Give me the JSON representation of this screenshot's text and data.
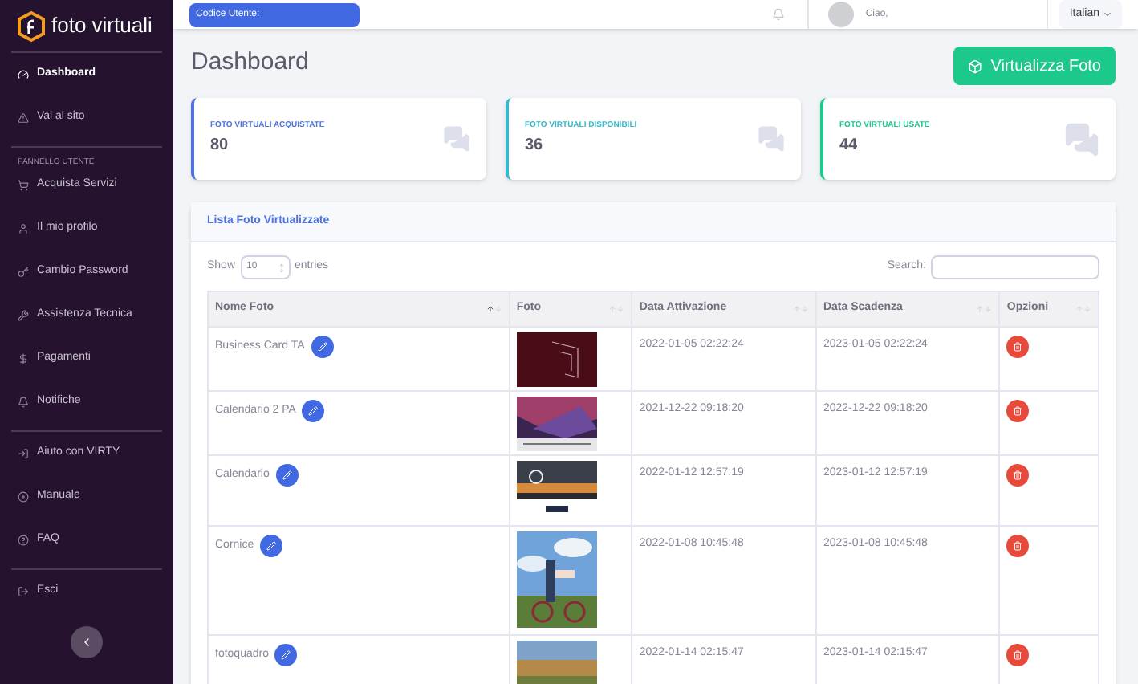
{
  "brand": {
    "name": "foto virtuali"
  },
  "sidebar": {
    "sections": [
      {
        "items": [
          {
            "label": "Dashboard",
            "selected": true
          },
          {
            "label": "Vai al sito",
            "selected": false
          }
        ]
      },
      {
        "heading": "PANNELLO UTENTE",
        "items": [
          {
            "label": "Acquista Servizi",
            "selected": false
          },
          {
            "label": "Il mio profilo",
            "selected": false
          },
          {
            "label": "Cambio Password",
            "selected": false
          },
          {
            "label": "Assistenza Tecnica",
            "selected": false
          },
          {
            "label": "Pagamenti",
            "selected": false
          },
          {
            "label": "Notifiche",
            "selected": false
          }
        ]
      },
      {
        "items": [
          {
            "label": "Aiuto con VIRTY",
            "selected": false
          },
          {
            "label": "Manuale",
            "selected": false
          },
          {
            "label": "FAQ",
            "selected": false
          }
        ]
      },
      {
        "items": [
          {
            "label": "Esci",
            "selected": false
          }
        ]
      }
    ]
  },
  "topbar": {
    "user_code": "Codice Utente:",
    "greeting": "Ciao,",
    "language": "Italian"
  },
  "page_title": "Dashboard",
  "primary_button": "Virtualizza Foto",
  "stats": [
    {
      "label": "FOTO VIRTUALI ACQUISTATE",
      "value": "80",
      "color": "#4e73df"
    },
    {
      "label": "FOTO VIRTUALI DISPONIBILI",
      "value": "36",
      "color": "#36b9cc"
    },
    {
      "label": "FOTO VIRTUALI USATE",
      "value": "44",
      "color": "#1cc88a"
    }
  ],
  "table_card": {
    "title": "Lista Foto Virtualizzate",
    "show_label": "Show",
    "page_size": "10",
    "entries_label": "entries",
    "search_label": "Search:",
    "columns": [
      {
        "label": "Nome Foto",
        "sorted": true
      },
      {
        "label": "Foto",
        "sorted": false
      },
      {
        "label": "Data Attivazione",
        "sorted": false
      },
      {
        "label": "Data Scadenza",
        "sorted": false
      },
      {
        "label": "Opzioni",
        "sorted": false
      }
    ],
    "rows": [
      {
        "name": "Business Card TA",
        "activated": "2022-01-05 02:22:24",
        "expires": "2023-01-05 02:22:24"
      },
      {
        "name": "Calendario 2 PA",
        "activated": "2021-12-22 09:18:20",
        "expires": "2022-12-22 09:18:20"
      },
      {
        "name": "Calendario",
        "activated": "2022-01-12 12:57:19",
        "expires": "2023-01-12 12:57:19"
      },
      {
        "name": "Cornice",
        "activated": "2022-01-08 10:45:48",
        "expires": "2023-01-08 10:45:48"
      },
      {
        "name": "fotoquadro",
        "activated": "2022-01-14 02:15:47",
        "expires": "2023-01-14 02:15:47"
      }
    ]
  }
}
